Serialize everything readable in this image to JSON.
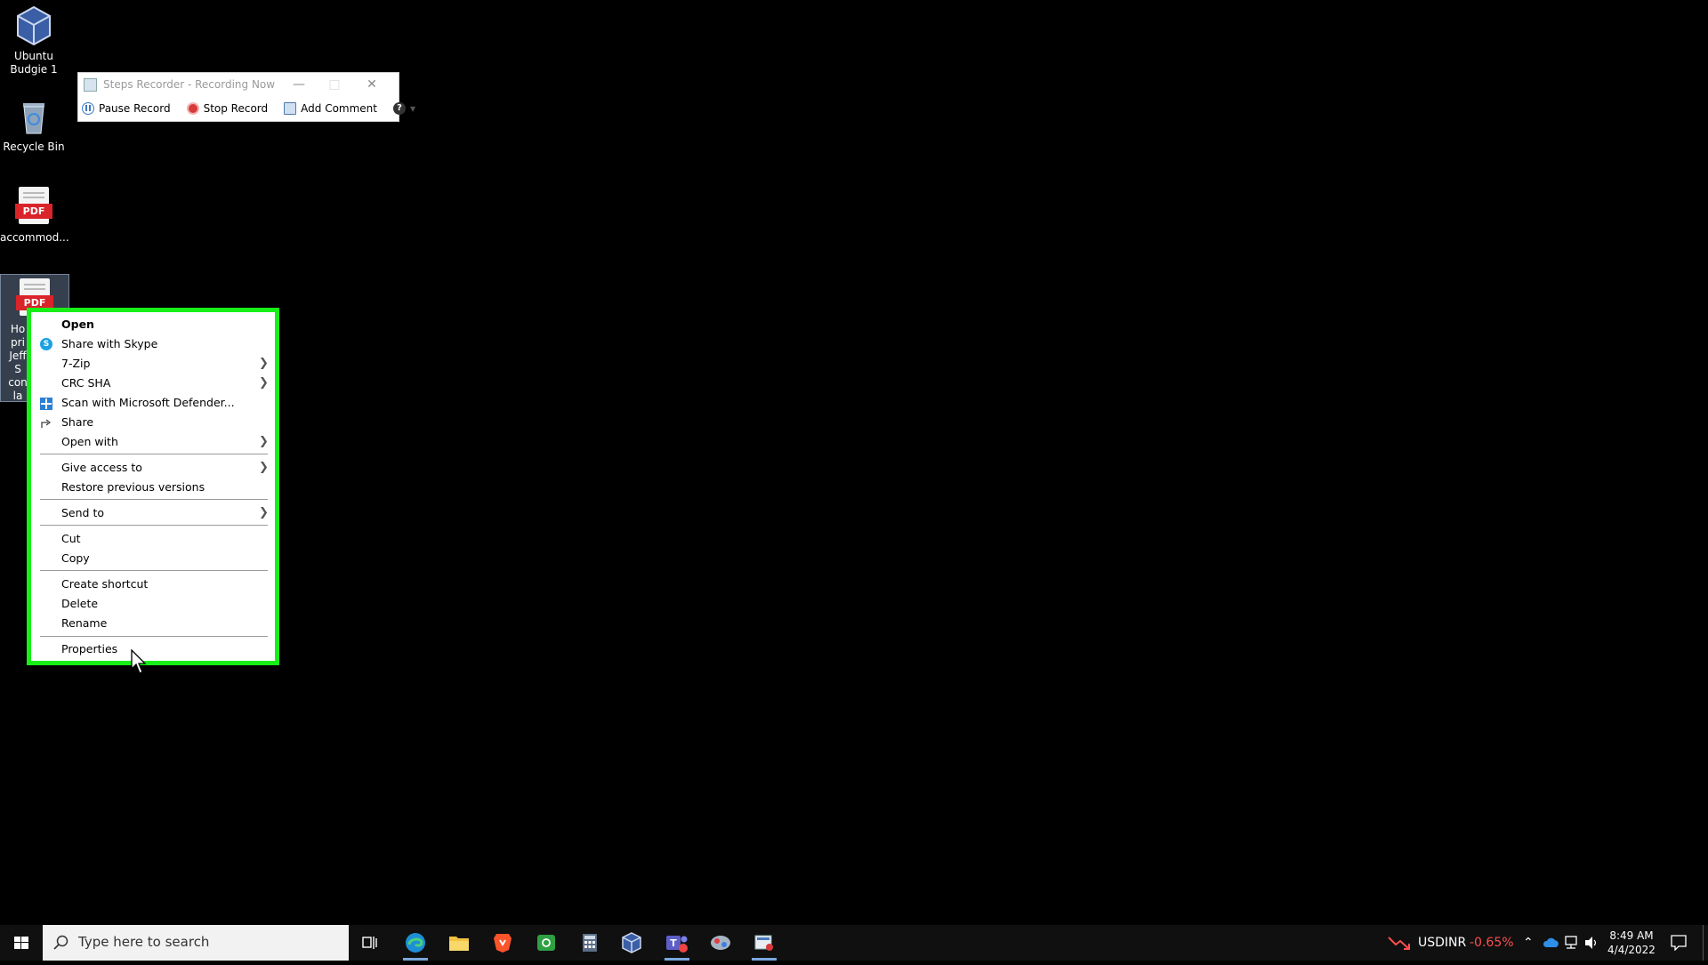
{
  "desktop": {
    "icons": [
      {
        "label_line1": "Ubuntu",
        "label_line2": "Budgie 1"
      },
      {
        "label_line1": "Recycle Bin"
      },
      {
        "label_line1": "accommod..."
      },
      {
        "label_line1": "Ho pri Jeff S con la"
      }
    ],
    "pdf_tag": "PDF"
  },
  "steps_recorder": {
    "title": "Steps Recorder - Recording Now",
    "pause": "Pause Record",
    "stop": "Stop Record",
    "comment": "Add Comment"
  },
  "context_menu": {
    "items": [
      "Open",
      "Share with Skype",
      "7-Zip",
      "CRC SHA",
      "Scan with Microsoft Defender...",
      "Share",
      "Open with",
      "Give access to",
      "Restore previous versions",
      "Send to",
      "Cut",
      "Copy",
      "Create shortcut",
      "Delete",
      "Rename",
      "Properties"
    ]
  },
  "taskbar": {
    "search_placeholder": "Type here to search",
    "ticker_symbol": "USDINR",
    "ticker_change": "-0.65%",
    "time": "8:49 AM",
    "date": "4/4/2022"
  },
  "colors": {
    "highlight_outline": "#18ef18",
    "ticker_negative": "#ff4e4e",
    "pdf_red": "#d9242a"
  }
}
